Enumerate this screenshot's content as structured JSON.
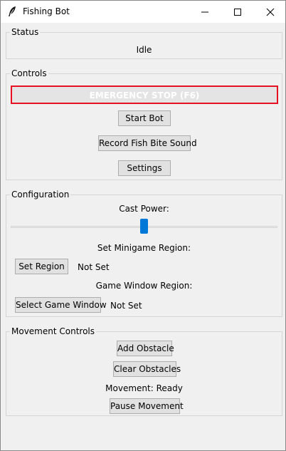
{
  "window": {
    "title": "Fishing Bot",
    "icon": "feather-icon"
  },
  "status": {
    "legend": "Status",
    "text": "Idle"
  },
  "controls": {
    "legend": "Controls",
    "emergency_stop_label": "EMERGENCY STOP (F6)",
    "start_label": "Start Bot",
    "record_label": "Record Fish Bite Sound",
    "settings_label": "Settings"
  },
  "configuration": {
    "legend": "Configuration",
    "cast_power_label": "Cast Power:",
    "cast_power_value": 0.5,
    "minigame_region_label": "Set Minigame Region:",
    "set_region_label": "Set Region",
    "minigame_region_status": "Not Set",
    "game_window_label": "Game Window Region:",
    "select_window_label": "Select Game Window",
    "game_window_status": "Not Set"
  },
  "movement": {
    "legend": "Movement Controls",
    "add_obstacle_label": "Add Obstacle",
    "clear_obstacles_label": "Clear Obstacles",
    "status": "Movement: Ready",
    "pause_label": "Pause Movement"
  },
  "colors": {
    "emergency_border": "#e81123",
    "slider_accent": "#0078d7"
  }
}
